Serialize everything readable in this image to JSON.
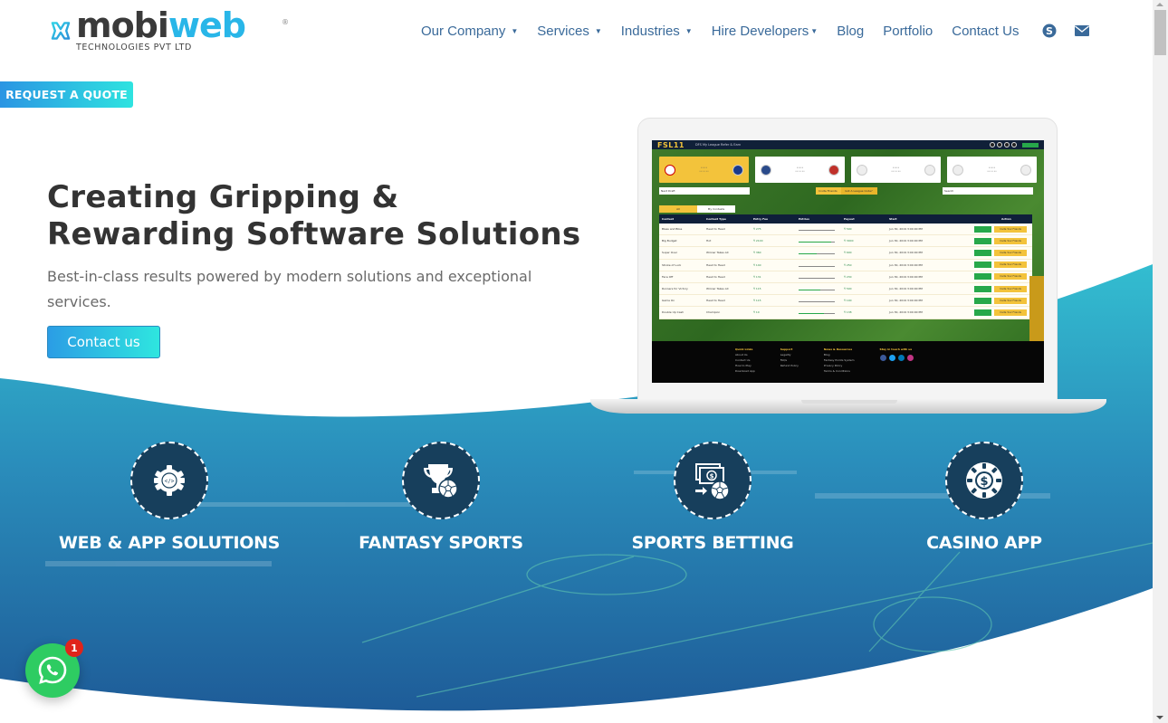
{
  "header": {
    "logo": {
      "word_dark": "mobi",
      "word_accent": "web",
      "registered": "®",
      "subtitle": "TECHNOLOGIES PVT LTD"
    },
    "nav": [
      {
        "label": "Our Company",
        "dropdown": true
      },
      {
        "label": "Services",
        "dropdown": true
      },
      {
        "label": "Industries",
        "dropdown": true
      },
      {
        "label": "Hire Developers",
        "dropdown": true
      },
      {
        "label": "Blog",
        "dropdown": false
      },
      {
        "label": "Portfolio",
        "dropdown": false
      },
      {
        "label": "Contact Us",
        "dropdown": false
      }
    ],
    "nav_icons": [
      "skype-icon",
      "envelope-icon"
    ],
    "caret": "▼"
  },
  "quote_button": "REQUEST A QUOTE",
  "hero": {
    "title_line1": "Creating Gripping &",
    "title_line2": "Rewarding Software Solutions",
    "subtitle": "Best-in-class results powered by modern solutions and exceptional services.",
    "cta": "Contact us"
  },
  "screenshot": {
    "app_logo_a": "FSL",
    "app_logo_b": "11",
    "menu": "DFS   My League   Refer & Earn",
    "next_draft": "Next Draft",
    "invite_friends": "Invite Friends",
    "league_code": "Got A League Code?",
    "search": "Search",
    "tabs": [
      "All",
      "My Contests"
    ],
    "table_headers": [
      "Contest",
      "Contest Type",
      "Entry Fee",
      "Entries",
      "Payout",
      "Start",
      "Action"
    ],
    "rows": [
      {
        "contest": "Bless and Bliss",
        "type": "Head to Head",
        "fee": "₹ 275",
        "fill": 0.0,
        "payout": "₹ 500",
        "start": "Jun 30, 2019 3:00:00 PM"
      },
      {
        "contest": "Big Budget",
        "type": "Hot",
        "fee": "₹ 2100",
        "fill": 0.9,
        "payout": "₹ 3000",
        "start": "Jun 30, 2019 3:00:00 PM"
      },
      {
        "contest": "Super Over",
        "type": "Winner Takes All",
        "fee": "₹ 360",
        "fill": 0.5,
        "payout": "₹ 600",
        "start": "Jun 30, 2019 3:00:00 PM"
      },
      {
        "contest": "Stroke of Luck",
        "type": "Head to Head",
        "fee": "₹ 140",
        "fill": 0.0,
        "payout": "₹ 250",
        "start": "Jun 30, 2019 3:00:00 PM"
      },
      {
        "contest": "Face Off",
        "type": "Head to Head",
        "fee": "₹ 131",
        "fill": 0.0,
        "payout": "₹ 230",
        "start": "Jun 30, 2019 3:00:00 PM"
      },
      {
        "contest": "Runners for Victory",
        "type": "Winner Takes All",
        "fee": "₹ 115",
        "fill": 0.6,
        "payout": "₹ 500",
        "start": "Jun 30, 2019 3:00:00 PM"
      },
      {
        "contest": "Game On",
        "type": "Head to Head",
        "fee": "₹ 115",
        "fill": 0.0,
        "payout": "₹ 100",
        "start": "Jun 30, 2019 3:00:00 PM"
      },
      {
        "contest": "Double Up Cash",
        "type": "Champion",
        "fee": "₹ 10",
        "fill": 0.7,
        "payout": "₹ 138",
        "start": "Jun 30, 2019 3:00:00 PM"
      }
    ],
    "join_label": "Join",
    "invite_label": "Invite Your Friends",
    "footer": [
      {
        "title": "Quick Links",
        "items": [
          "About Us",
          "Contact Us",
          "How to Play",
          "Download App"
        ]
      },
      {
        "title": "Support",
        "items": [
          "Legality",
          "FAQs",
          "Refund Policy"
        ]
      },
      {
        "title": "News & Resources",
        "items": [
          "Blog",
          "Fantasy Points System",
          "Privacy Policy",
          "Terms & Conditions"
        ]
      },
      {
        "title": "Stay in touch with us",
        "items": []
      }
    ],
    "social_colors": [
      "#3b5998",
      "#1da1f2",
      "#0077b5",
      "#c13584"
    ]
  },
  "services": [
    {
      "label": "WEB & APP SOLUTIONS",
      "icon": "gear-code-icon"
    },
    {
      "label": "FANTASY SPORTS",
      "icon": "trophy-ball-icon"
    },
    {
      "label": "SPORTS BETTING",
      "icon": "money-ball-icon"
    },
    {
      "label": "CASINO APP",
      "icon": "casino-chip-icon"
    }
  ],
  "whatsapp": {
    "badge": "1"
  },
  "colors": {
    "nav": "#3a6a9a",
    "accent_start": "#2b95e3",
    "accent_end": "#2ee3e0",
    "wave_top": "#2fb3cc",
    "wave_bottom": "#1f5f9a",
    "whatsapp": "#2ecc62"
  }
}
